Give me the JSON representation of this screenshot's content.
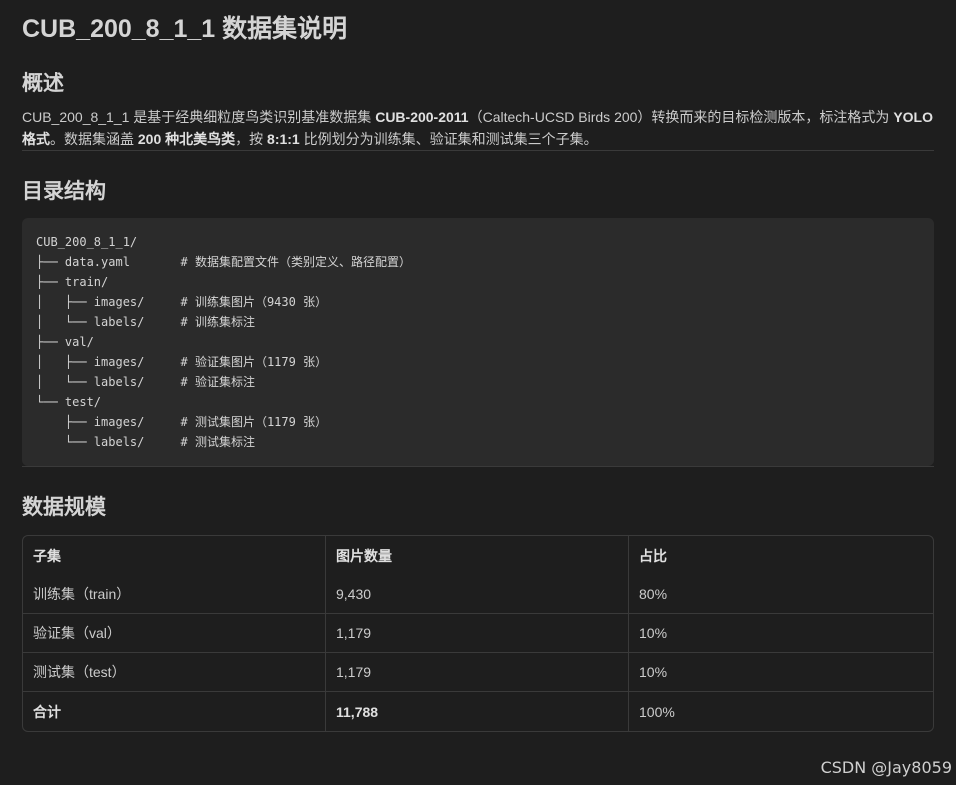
{
  "title": "CUB_200_8_1_1 数据集说明",
  "overview": {
    "heading": "概述",
    "p1": "CUB_200_8_1_1 是基于经典细粒度鸟类识别基准数据集 ",
    "p1_bold": "CUB-200-2011",
    "p2": "（Caltech-UCSD Birds 200）转换而来的目标检测版本，标注格式为 ",
    "p2_bold": "YOLO 格式",
    "p3": "。数据集涵盖 ",
    "p3_bold": "200 种北美鸟类",
    "p4": "，按 ",
    "p4_bold": "8:1:1",
    "p5": " 比例划分为训练集、验证集和测试集三个子集。"
  },
  "tree": {
    "heading": "目录结构",
    "lines": [
      "CUB_200_8_1_1/",
      "├── data.yaml       # 数据集配置文件（类别定义、路径配置）",
      "├── train/",
      "│   ├── images/     # 训练集图片（9430 张）",
      "│   └── labels/     # 训练集标注",
      "├── val/",
      "│   ├── images/     # 验证集图片（1179 张）",
      "│   └── labels/     # 验证集标注",
      "└── test/",
      "    ├── images/     # 测试集图片（1179 张）",
      "    └── labels/     # 测试集标注"
    ]
  },
  "scale": {
    "heading": "数据规模",
    "headers": [
      "子集",
      "图片数量",
      "占比"
    ],
    "rows": [
      [
        "训练集（train）",
        "9,430",
        "80%"
      ],
      [
        "验证集（val）",
        "1,179",
        "10%"
      ],
      [
        "测试集（test）",
        "1,179",
        "10%"
      ],
      [
        "合计",
        "11,788",
        "100%"
      ]
    ]
  },
  "watermark": "CSDN @Jay8059"
}
